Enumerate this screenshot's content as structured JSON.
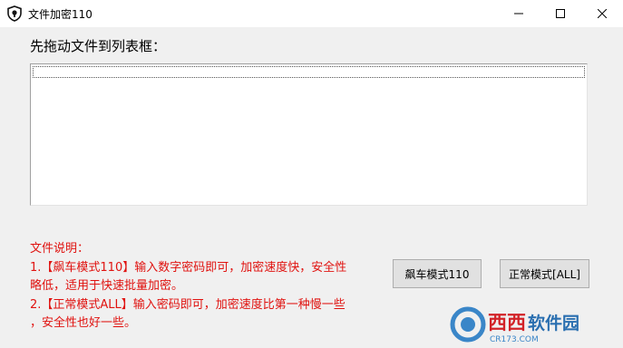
{
  "window": {
    "title": "文件加密110"
  },
  "main": {
    "prompt": "先拖动文件到列表框：",
    "file_list": []
  },
  "notes": {
    "heading": "文件说明：",
    "line1": "1.【飙车模式110】输入数字密码即可，加密速度快，安全性",
    "line2": "略低，适用于快速批量加密。",
    "line3": "2.【正常模式ALL】输入密码即可，加密速度比第一种慢一些",
    "line4": "，安全性也好一些。"
  },
  "buttons": {
    "fast_mode": "飙车模式110",
    "normal_mode": "正常模式[ALL]"
  },
  "watermark": {
    "brand": "西西软件园",
    "site": "CR173.COM"
  },
  "colors": {
    "note_text": "#e0120f",
    "watermark_brand": "#d22227"
  }
}
